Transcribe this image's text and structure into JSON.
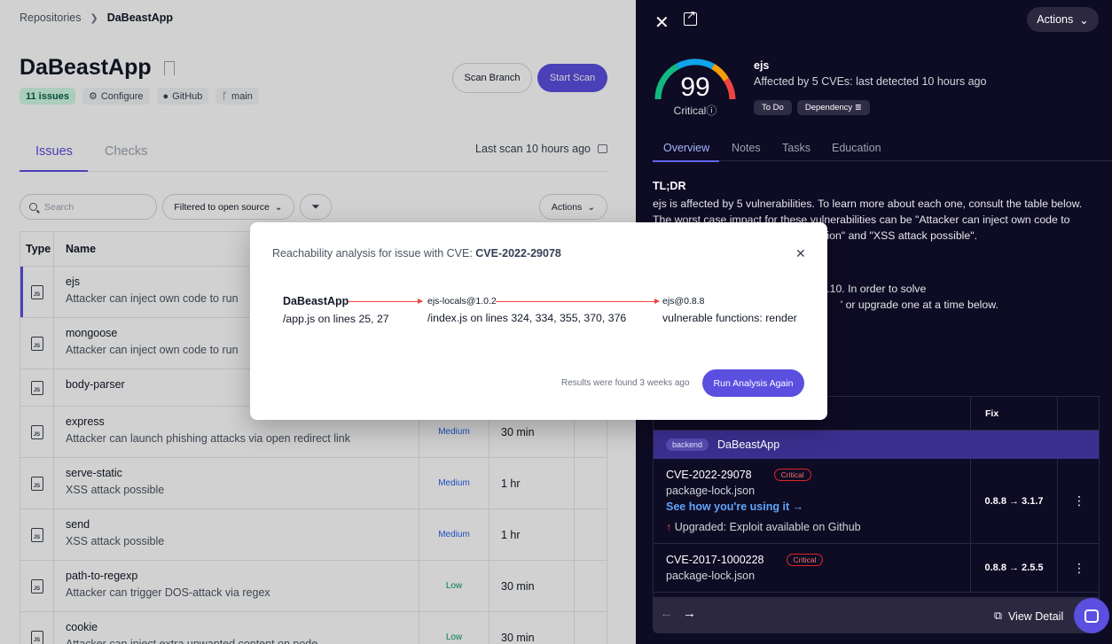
{
  "breadcrumb": {
    "root": "Repositories",
    "current": "DaBeastApp"
  },
  "repo": {
    "title": "DaBeastApp",
    "chips": [
      "11 issues",
      "Configure",
      "GitHub",
      "main"
    ],
    "scan_branch_label": "Scan Branch",
    "start_scan_label": "Start Scan"
  },
  "tabs": {
    "issues": "Issues",
    "checks": "Checks",
    "last_scan": "Last scan 10 hours ago"
  },
  "toolbar": {
    "search_placeholder": "Search",
    "filter_label": "Filtered to open source",
    "actions_label": "Actions"
  },
  "table": {
    "headers": {
      "type": "Type",
      "name": "Name"
    },
    "rows": [
      {
        "pkg": "ejs",
        "desc": "Attacker can inject own code to run",
        "severity": "",
        "time": ""
      },
      {
        "pkg": "mongoose",
        "desc": "Attacker can inject own code to run",
        "severity": "",
        "time": ""
      },
      {
        "pkg": "body-parser",
        "desc": "",
        "severity": "",
        "time": ""
      },
      {
        "pkg": "express",
        "desc": "Attacker can launch phishing attacks via open redirect link",
        "severity": "Medium",
        "time": "30 min"
      },
      {
        "pkg": "serve-static",
        "desc": "XSS attack possible",
        "severity": "Medium",
        "time": "1 hr"
      },
      {
        "pkg": "send",
        "desc": "XSS attack possible",
        "severity": "Medium",
        "time": "1 hr"
      },
      {
        "pkg": "path-to-regexp",
        "desc": "Attacker can trigger DOS-attack via regex",
        "severity": "Low",
        "time": "30 min"
      },
      {
        "pkg": "cookie",
        "desc": "Attacker can inject extra unwanted content on node",
        "severity": "Low",
        "time": "30 min"
      }
    ],
    "js_label": "JS"
  },
  "detail": {
    "actions_label": "Actions",
    "score": "99",
    "score_level": 0.99,
    "score_label": "Critical",
    "pkg": "ejs",
    "affected": "Affected by 5 CVEs: last detected 10 hours ago",
    "tags": [
      "To Do",
      "Dependency"
    ],
    "tabs": [
      "Overview",
      "Notes",
      "Tasks",
      "Education"
    ],
    "tldr_heading": "TL;DR",
    "tldr_text": "ejs is affected by 5 vulnerabilities. To learn more about each one, consult the table below. The worst case impact for these vulnerabilities can be \"Attacker can inject own code to run\",                                             dation\" and \"XSS attack possible\".",
    "fix_text": "es, update ejs in DaBeastApp to 3.1.10. In order to solve                                                                                                                     ' or upgrade one at a time below.",
    "fix_header": "Fix",
    "group_badge": "backend",
    "group_name": "DaBeastApp",
    "vulns": [
      {
        "cve": "CVE-2022-29078",
        "severity": "Critical",
        "file": "package-lock.json",
        "link": "See how you're using it →",
        "upgrade": "Upgraded: Exploit available on Github",
        "fix": "0.8.8 → 3.1.7"
      },
      {
        "cve": "CVE-2017-1000228",
        "severity": "Critical",
        "file": "package-lock.json",
        "fix": "0.8.8 → 2.5.5"
      }
    ],
    "view_detail": "View Detail"
  },
  "modal": {
    "title_prefix": "Reachability analysis for issue with CVE: ",
    "cve": "CVE-2022-29078",
    "nodes": [
      {
        "title": "DaBeastApp",
        "sub": "/app.js on lines 25, 27"
      },
      {
        "title": "ejs-locals@1.0.2",
        "sub": "/index.js on lines 324, 334, 355, 370, 376"
      },
      {
        "title": "ejs@0.8.8",
        "sub": "vulnerable functions: render"
      }
    ],
    "found": "Results were found 3 weeks ago",
    "run_again": "Run Analysis Again"
  },
  "colors": {
    "accent": "#5b4fe0",
    "dark_bg": "#0e0b24",
    "critical": "#ef4444"
  }
}
